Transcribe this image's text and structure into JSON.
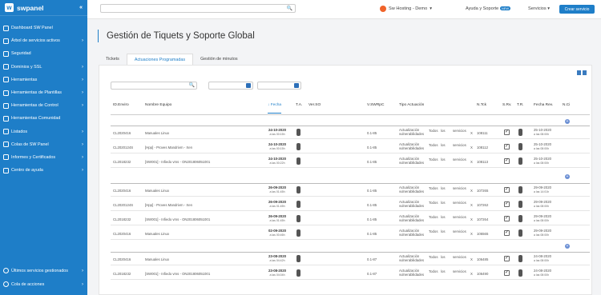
{
  "app": {
    "name": "swpanel",
    "logo_letter": "w",
    "collapse_label": "«"
  },
  "sidebar": {
    "items": [
      {
        "label": "Dashboard SW Panel",
        "chev": ""
      },
      {
        "label": "Árbol de servicios activos",
        "chev": "›"
      },
      {
        "label": "Seguridad",
        "chev": ""
      },
      {
        "label": "Dominios y SSL",
        "chev": "›"
      },
      {
        "label": "Herramientas",
        "chev": "›"
      },
      {
        "label": "Herramientas de Plantillas",
        "chev": "›"
      },
      {
        "label": "Herramientas de Control",
        "chev": "›"
      },
      {
        "label": "Herramientas Comunidad",
        "chev": ""
      },
      {
        "label": "Listados",
        "chev": "›"
      },
      {
        "label": "Colas de SW Panel",
        "chev": "›"
      },
      {
        "label": "Informes y Certificados",
        "chev": "›"
      },
      {
        "label": "Centro de ayuda",
        "chev": "›"
      }
    ],
    "bottom": [
      {
        "label": "Últimos servicios gestionados",
        "chev": "›"
      },
      {
        "label": "Cola de acciones",
        "chev": "›"
      }
    ]
  },
  "topbar": {
    "search_icon": "🔍",
    "account": "Sw Hosting - Demo",
    "account_chev": "▾",
    "ayuda": "Ayuda y Soporte",
    "ayuda_badge": "NEW",
    "servicios": "Servicios ▾",
    "crear": "Crear servicio"
  },
  "page": {
    "title": "Gestión de Tiquets y Soporte Global"
  },
  "tabs": [
    {
      "label": "Tickets"
    },
    {
      "label": "Actuaciones Programadas"
    },
    {
      "label": "Gestión de minutos"
    }
  ],
  "table": {
    "headers": {
      "id": "ID.Enviro",
      "name": "Nombre Equipo",
      "fecha": "↓ Fecha",
      "ta": "T.A.",
      "verso": "Ver.SO",
      "vswr": "V.SWRpC",
      "tipo": "Tipo Actuación",
      "ntck": "N.Tck",
      "srv": "S.Rv.",
      "tr": "T.R.",
      "fecharev": "Fecha Rev.",
      "nci": "N.Ci"
    },
    "plus": "+",
    "rows": [
      {
        "id": "CL2020416",
        "name": "Manuales Linux",
        "date": "24-10-2020",
        "time": "a las 00:15h",
        "vs": "0.1-85",
        "tipo1": "Actualización",
        "tipo1b": "vulnerabilidades",
        "t2": "Todos",
        "t3": "los",
        "t4": "servicios",
        "x": "X",
        "ntck": "108111",
        "rev": "25-10-2020",
        "revt": "a las 08:00h"
      },
      {
        "id": "CL2020124S",
        "name": "[Hpp] - Proves Mandrivm - Xen",
        "date": "24-10-2020",
        "time": "a las 00:15h",
        "vs": "0.1-85",
        "tipo1": "Actualización",
        "tipo1b": "vulnerabilidades",
        "t2": "Todos",
        "t3": "los",
        "t4": "servicios",
        "x": "X",
        "ntck": "108112",
        "rev": "25-10-2020",
        "revt": "a las 08:00h"
      },
      {
        "id": "CL2018232",
        "name": "[SW001] - Infiedo vms - ON201806051001",
        "date": "24-10-2020",
        "time": "a las 00:22h",
        "vs": "0.1-85",
        "tipo1": "Actualización",
        "tipo1b": "vulnerabilidades",
        "t2": "Todos",
        "t3": "los",
        "t4": "servicios",
        "x": "X",
        "ntck": "108113",
        "rev": "25-10-2020",
        "revt": "a las 08:00h"
      },
      {
        "id": "CL2020416",
        "name": "Manuales Linux",
        "date": "26-09-2020",
        "time": "a las 01:45h",
        "vs": "0.1-85",
        "tipo1": "Actualización",
        "tipo1b": "vulnerabilidades",
        "t2": "Todos",
        "t3": "los",
        "t4": "servicios",
        "x": "X",
        "ntck": "107265",
        "rev": "29-09-2020",
        "revt": "a las 14:01h"
      },
      {
        "id": "CL2020124S",
        "name": "[Hpp] - Proves Mandrivm - Xen",
        "date": "26-09-2020",
        "time": "a las 01:45h",
        "vs": "0.1-85",
        "tipo1": "Actualización",
        "tipo1b": "vulnerabilidades",
        "t2": "Todos",
        "t3": "los",
        "t4": "servicios",
        "x": "X",
        "ntck": "107262",
        "rev": "29-09-2020",
        "revt": "a las 08:00h"
      },
      {
        "id": "CL2018232",
        "name": "[SW001] - Infiedo vms - ON201806051001",
        "date": "26-09-2020",
        "time": "a las 01:45h",
        "vs": "0.1-85",
        "tipo1": "Actualización",
        "tipo1b": "vulnerabilidades",
        "t2": "Todos",
        "t3": "los",
        "t4": "servicios",
        "x": "X",
        "ntck": "107264",
        "rev": "29-09-2020",
        "revt": "a las 08:00h"
      },
      {
        "id": "CL2020416",
        "name": "Manuales Linux",
        "date": "02-09-2020",
        "time": "a las 00:46h",
        "vs": "0.1-85",
        "tipo1": "Actualización",
        "tipo1b": "vulnerabilidades",
        "t2": "Todos",
        "t3": "los",
        "t4": "servicios",
        "x": "X",
        "ntck": "106565",
        "rev": "29-09-2020",
        "revt": "a las 08:00h"
      },
      {
        "id": "CL2020416",
        "name": "Manuales Linux",
        "date": "23-08-2020",
        "time": "a las 04:42h",
        "vs": "0.1-87",
        "tipo1": "Actualización",
        "tipo1b": "vulnerabilidades",
        "t2": "Todos",
        "t3": "los",
        "t4": "servicios",
        "x": "X",
        "ntck": "106485",
        "rev": "24-08-2020",
        "revt": "a las 08:00h"
      },
      {
        "id": "CL2018232",
        "name": "[SW001] - Infiedo vms - ON201806051001",
        "date": "23-08-2020",
        "time": "a las 04:04h",
        "vs": "0.1-87",
        "tipo1": "Actualización",
        "tipo1b": "vulnerabilidades",
        "t2": "Todos",
        "t3": "los",
        "t4": "servicios",
        "x": "X",
        "ntck": "106490",
        "rev": "24-08-2020",
        "revt": "a las 08:00h"
      }
    ]
  }
}
